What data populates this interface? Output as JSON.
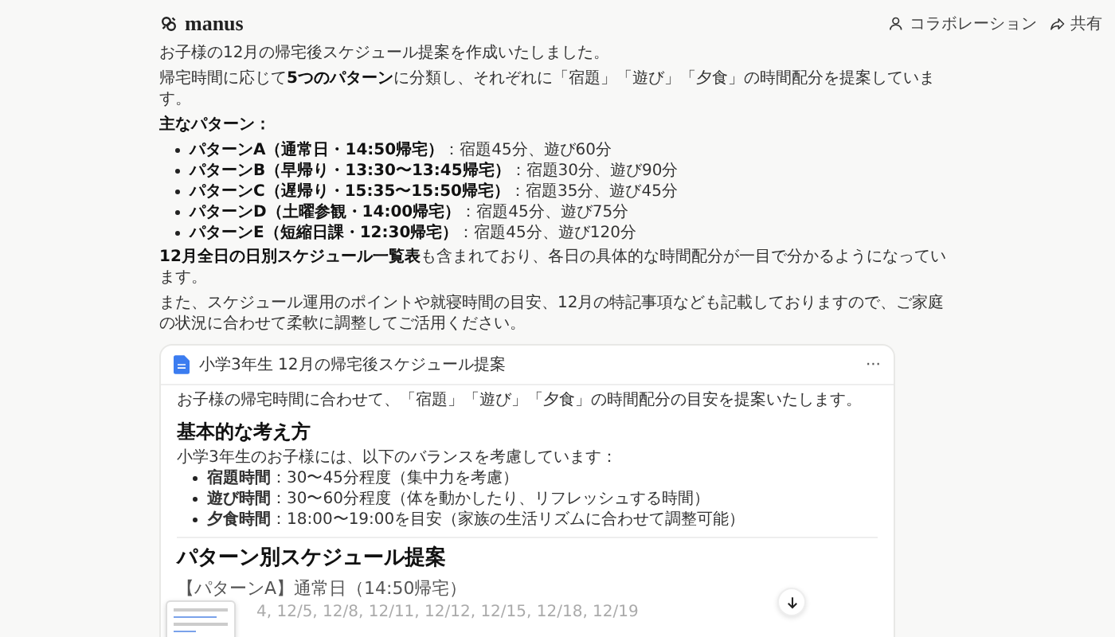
{
  "app": {
    "name": "manus"
  },
  "header_actions": [
    {
      "kind": "collab",
      "label": "コラボレーション"
    },
    {
      "kind": "share",
      "label": "共有"
    }
  ],
  "message": {
    "paragraphs": [
      "お子様の12月の帰宅後スケジュール提案を作成いたしました。",
      "帰宅時間に応じて**5つのパターン**に分類し、それぞれに「宿題」「遊び」「夕食」の時間配分を提案しています。"
    ],
    "list_title": "主なパターン：",
    "bullets": [
      "**パターンA（通常日・14:50帰宅）**：宿題45分、遊び60分",
      "**パターンB（早帰り・13:30〜13:45帰宅）**：宿題30分、遊び90分",
      "**パターンC（遅帰り・15:35〜15:50帰宅）**：宿題35分、遊び45分",
      "**パターンD（土曜参観・14:00帰宅）**：宿題45分、遊び75分",
      "**パターンE（短縮日課・12:30帰宅）**：宿題45分、遊び120分"
    ],
    "closing": [
      "**12月全日の日別スケジュール一覧表**も含まれており、各日の具体的な時間配分が一目で分かるようになっています。",
      "また、スケジュール運用のポイントや就寝時間の目安、12月の特記事項なども記載しておりますので、ご家庭の状況に合わせて柔軟に調整してご活用ください。"
    ]
  },
  "document": {
    "title": "小学3年生 12月の帰宅後スケジュール提案",
    "menu": "···",
    "intro": "お子様の帰宅時間に合わせて、「宿題」「遊び」「夕食」の時間配分の目安を提案いたします。",
    "section1": {
      "heading": "基本的な考え方",
      "text": "小学3年生のお子様には、以下のバランスを考慮しています：",
      "bullets": [
        "**宿題時間**：30〜45分程度（集中力を考慮）",
        "**遊び時間**：30〜60分程度（体を動かしたり、リフレッシュする時間）",
        "**夕食時間**：18:00〜19:00を目安（家族の生活リズムに合わせて調整可能）"
      ]
    },
    "section2": {
      "heading": "パターン別スケジュール提案",
      "subheading": "【パターンA】通常日（14:50帰宅）",
      "dates": "4, 12/5, 12/8, 12/11, 12/12, 12/15, 12/18, 12/19"
    }
  }
}
